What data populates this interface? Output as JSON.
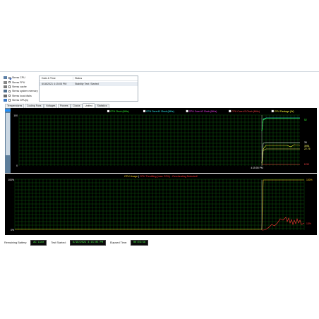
{
  "stress_options": [
    {
      "label": "Stress CPU",
      "checked": true,
      "icon": "cpu-icon"
    },
    {
      "label": "Stress FPU",
      "checked": false,
      "icon": "fpu-icon"
    },
    {
      "label": "Stress cache",
      "checked": false,
      "icon": "cache-icon"
    },
    {
      "label": "Stress system memory",
      "checked": false,
      "icon": "memory-icon"
    },
    {
      "label": "Stress local disks",
      "checked": false,
      "icon": "disk-icon"
    },
    {
      "label": "Stress GPU(s)",
      "checked": false,
      "icon": "gpu-icon"
    }
  ],
  "log": {
    "columns": [
      "Date & Time",
      "Status"
    ],
    "rows": [
      {
        "datetime": "6/18/2021 4:15:05 PM",
        "status": "Stability Test: Started"
      }
    ]
  },
  "tabs": {
    "items": [
      "Temperatures",
      "Cooling Fans",
      "Voltages",
      "Powers",
      "Clocks",
      "Unified",
      "Statistics"
    ],
    "active": "Unified"
  },
  "graph_upper": {
    "legend": [
      {
        "label": "CPU Clock (MHz)",
        "color": "#33ff33",
        "checked": true
      },
      {
        "label": "CPU Core #1 Clock (MHz)",
        "color": "#33ffff",
        "checked": true
      },
      {
        "label": "CPU Core #2 Clock (MHz)",
        "color": "#ff44ff",
        "checked": true
      },
      {
        "label": "CPU Core #3 Clock (MHz)",
        "color": "#ff4444",
        "checked": true
      },
      {
        "label": "CPU Package (W)",
        "color": "#ffff33",
        "checked": true
      }
    ],
    "y_top": "100",
    "y_bottom": "0",
    "time_label": "4:15:05 PM",
    "right_values": [
      {
        "text": "52",
        "color": "#33ff33"
      },
      {
        "text": "35",
        "color": "#ffffff"
      },
      {
        "text": "3991",
        "color": "#ffff66"
      },
      {
        "text": "22.76",
        "color": "#ffff66"
      },
      {
        "text": "8.35",
        "color": "#ff4444"
      }
    ],
    "grid_color": "#0f6b0f"
  },
  "graph_lower": {
    "title_a": "CPU Usage",
    "title_sep": " | ",
    "title_b": "CPU Throttling (max: 22%) - Overheating Detected!",
    "title_a_color": "#ffd21f",
    "title_b_color": "#ff3333",
    "y_top": "100%",
    "y_bottom": "0%",
    "right_top": "100%",
    "right_bottom": "13%",
    "grid_color": "#0f6b0f"
  },
  "status_bar": {
    "battery_label": "Remaining Battery:",
    "battery_value": "AC Line",
    "started_label": "Test Started:",
    "started_value": "6/18/2021 4:15:05 PM",
    "elapsed_label": "Elapsed Time:",
    "elapsed_value": "00:03:56"
  }
}
